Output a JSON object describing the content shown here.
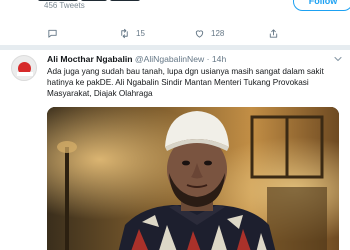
{
  "previous_tweet": {
    "tweets_count": "456 Tweets",
    "follow_label": "Follow",
    "retweets": "15",
    "likes": "128"
  },
  "tweet": {
    "author_name": "Ali Mocthar Ngabalin",
    "author_handle": "@AliNgabalinNew",
    "separator": "·",
    "time": "14h",
    "text": "Ada juga yang sudah bau tanah, lupa dgn usianya masih sangat dalam sakit hatinya ke pakDE. Ali Ngabalin Sindir Mantan Menteri Tukang Provokasi Masyarakat,  Diajak Olahraga"
  },
  "icons": {
    "reply": "reply-icon",
    "retweet": "retweet-icon",
    "like": "heart-icon",
    "share": "share-icon",
    "more": "chevron-down-icon"
  },
  "colors": {
    "accent": "#1da1f2",
    "muted": "#657786",
    "divider": "#e6ecf0"
  }
}
